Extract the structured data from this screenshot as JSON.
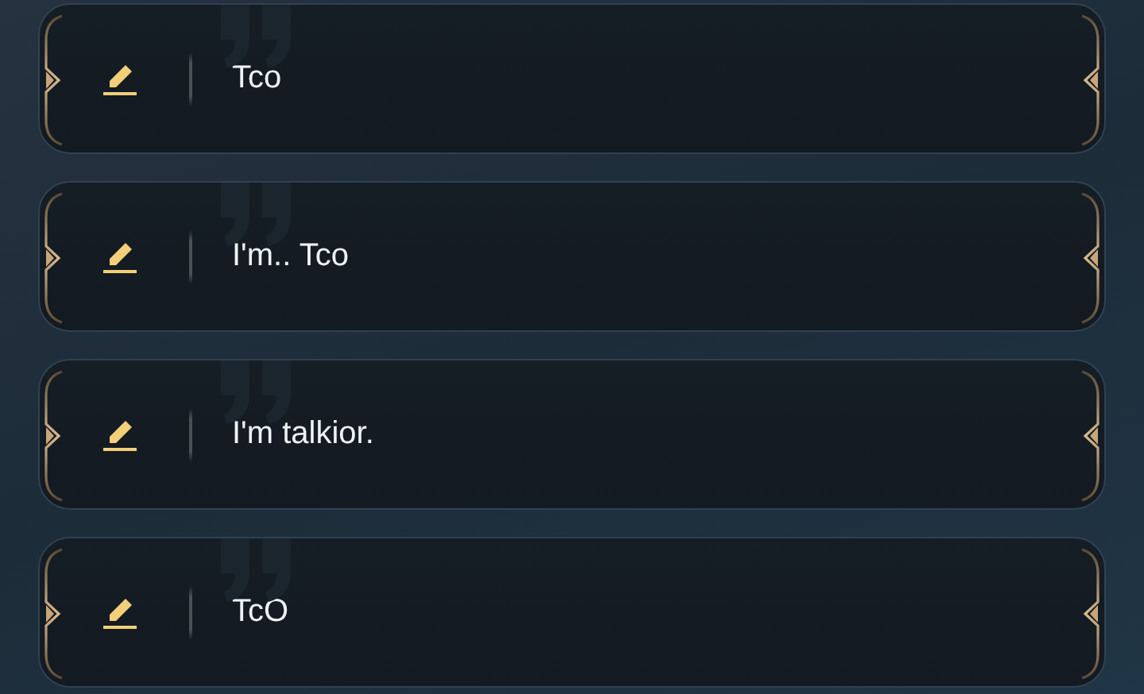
{
  "messages": [
    {
      "text": "Tco"
    },
    {
      "text": "I'm.. Tco"
    },
    {
      "text": "I'm talkior."
    },
    {
      "text": "TcO"
    }
  ]
}
